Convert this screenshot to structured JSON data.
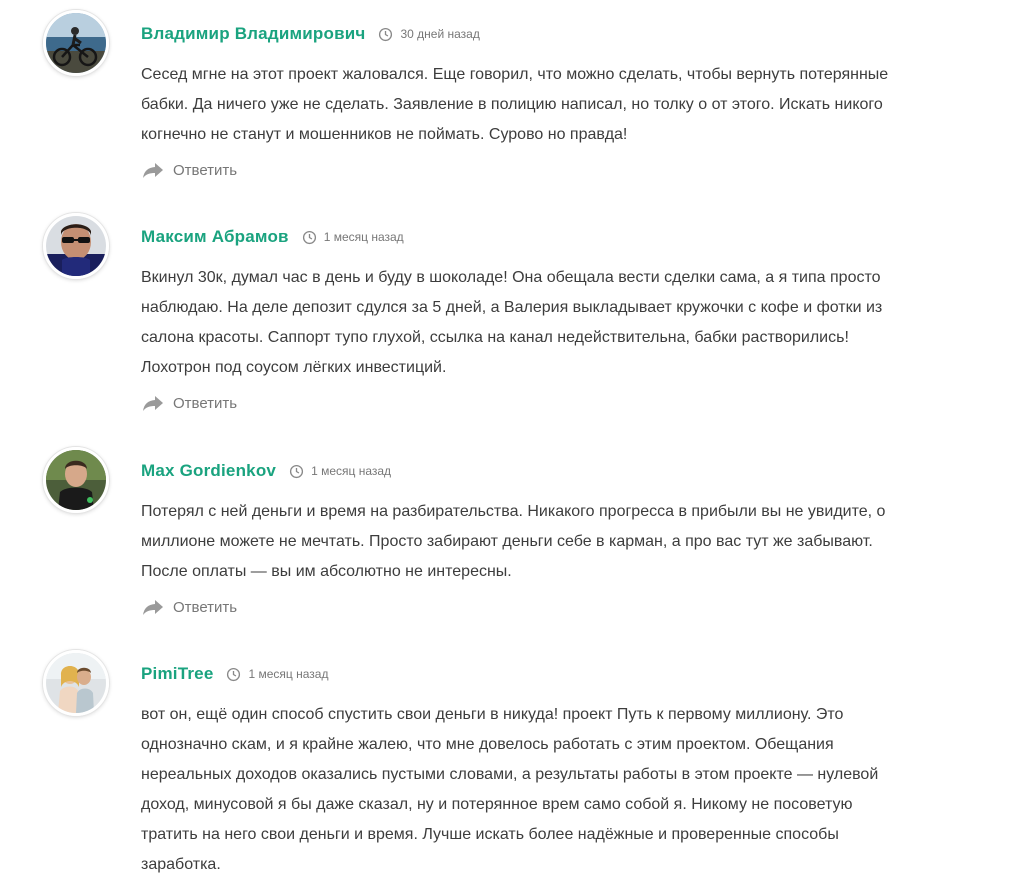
{
  "comments": [
    {
      "author": "Владимир Владимирович",
      "time": "30 дней назад",
      "lines": [
        "Сесед мгне на этот проект жаловался. Еще говорил, что можно сделать, чтобы вернуть потерянные",
        "бабки. Да ничего уже не сделать. Заявление в полицию написал, но толку о от этого. Искать никого",
        "когнечно не станут и мошенников не поймать. Сурово но правда!"
      ],
      "reply_label": "Ответить"
    },
    {
      "author": "Максим Абрамов",
      "time": "1 месяц назад",
      "lines": [
        "Вкинул 30к, думал час в день и буду в шоколаде! Она обещала вести сделки сама, а я типа просто",
        "наблюдаю. На деле депозит сдулся за 5 дней, а Валерия выкладывает кружочки с кофе и фотки из",
        "салона красоты. Саппорт тупо глухой, ссылка на канал недействительна, бабки растворились!",
        "Лохотрон под соусом лёгких инвестиций."
      ],
      "reply_label": "Ответить"
    },
    {
      "author": "Max Gordienkov",
      "time": "1 месяц назад",
      "lines": [
        "Потерял с ней деньги и время на разбирательства. Никакого прогресса в прибыли вы не увидите, о",
        "миллионе можете не мечтать. Просто забирают деньги себе в карман, а про вас тут же забывают.",
        "После оплаты — вы им абсолютно не интересны."
      ],
      "reply_label": "Ответить"
    },
    {
      "author": "PimiTree",
      "time": "1 месяц назад",
      "lines": [
        "вот он, ещё один способ спустить свои деньги в никуда! проект Путь к первому миллиону. Это",
        "однозначно скам, и я крайне жалею, что мне довелось работать с этим проектом. Обещания",
        "нереальных доходов оказались пустыми словами, а результаты работы в этом проекте — нулевой",
        "доход, минусовой я бы даже сказал, ну и потерянное врем само собой я. Никому не посоветую",
        "тратить на него свои деньги и время. Лучше искать более надёжные и проверенные способы",
        "заработка."
      ],
      "reply_label": ""
    }
  ],
  "icons": {
    "time": "clock-icon",
    "reply": "reply-arrow-icon"
  },
  "colors": {
    "author": "#1aa37f",
    "text": "#3d3d3d",
    "muted": "#777777",
    "reply_icon": "#9a9a9a"
  }
}
